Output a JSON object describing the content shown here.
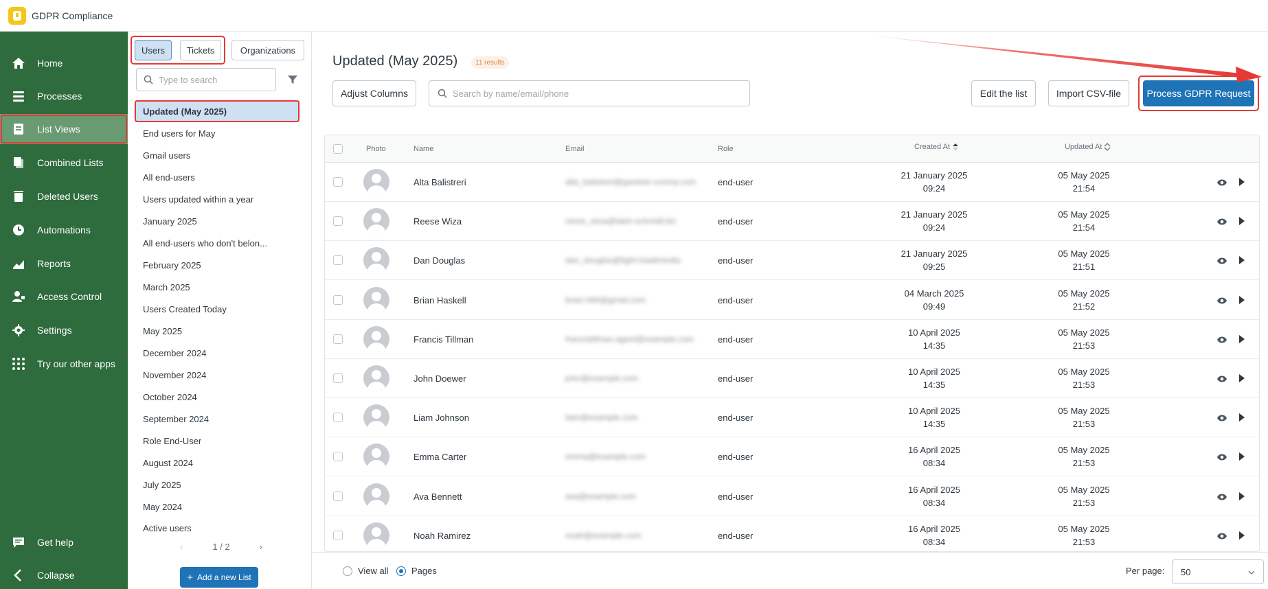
{
  "app": {
    "title": "GDPR Compliance"
  },
  "nav": {
    "items": [
      {
        "label": "Home",
        "icon": "home-icon"
      },
      {
        "label": "Processes",
        "icon": "processes-icon"
      },
      {
        "label": "List Views",
        "icon": "list-views-icon",
        "active": true
      },
      {
        "label": "Combined Lists",
        "icon": "combined-lists-icon"
      },
      {
        "label": "Deleted Users",
        "icon": "deleted-users-icon"
      },
      {
        "label": "Automations",
        "icon": "clock-icon"
      },
      {
        "label": "Reports",
        "icon": "reports-icon"
      },
      {
        "label": "Access Control",
        "icon": "access-control-icon"
      },
      {
        "label": "Settings",
        "icon": "gear-icon"
      },
      {
        "label": "Try our other apps",
        "icon": "apps-grid-icon"
      }
    ],
    "help": "Get help",
    "collapse": "Collapse"
  },
  "listpanel": {
    "tabs": [
      "Users",
      "Tickets",
      "Organizations"
    ],
    "search_placeholder": "Type to search",
    "items": [
      "Updated (May 2025)",
      "End users for May",
      "Gmail users",
      "All end-users",
      "Users updated within a year",
      "January 2025",
      "All end-users who don't belon...",
      "February 2025",
      "March 2025",
      "Users Created Today",
      "May 2025",
      "December 2024",
      "November 2024",
      "October 2024",
      "September 2024",
      "Role End-User",
      "August 2024",
      "July 2025",
      "May 2024",
      "Active users"
    ],
    "pager": "1 / 2",
    "add_button": "Add a new List"
  },
  "main": {
    "title": "Updated (May 2025)",
    "results": "11 results",
    "adjust_columns": "Adjust Columns",
    "search_placeholder": "Search by name/email/phone",
    "edit_list": "Edit the list",
    "import_csv": "Import CSV-file",
    "process_gdpr": "Process GDPR Request"
  },
  "table": {
    "columns": {
      "photo": "Photo",
      "name": "Name",
      "email": "Email",
      "role": "Role",
      "created": "Created At",
      "updated": "Updated At"
    },
    "rows": [
      {
        "name": "Alta Balistreri",
        "email": "alta_balistreri@gardner-conroy.com",
        "role": "end-user",
        "created_date": "21 January 2025",
        "created_time": "09:24",
        "updated_date": "05 May 2025",
        "updated_time": "21:54"
      },
      {
        "name": "Reese Wiza",
        "email": "reese_wiza@lakin-schmidt.biz",
        "role": "end-user",
        "created_date": "21 January 2025",
        "created_time": "09:24",
        "updated_date": "05 May 2025",
        "updated_time": "21:54"
      },
      {
        "name": "Dan Douglas",
        "email": "dan_douglas@light-hawkmedia",
        "role": "end-user",
        "created_date": "21 January 2025",
        "created_time": "09:25",
        "updated_date": "05 May 2025",
        "updated_time": "21:51"
      },
      {
        "name": "Brian Haskell",
        "email": "brian.h84@gmail.com",
        "role": "end-user",
        "created_date": "04 March 2025",
        "created_time": "09:49",
        "updated_date": "05 May 2025",
        "updated_time": "21:52"
      },
      {
        "name": "Francis Tillman",
        "email": "francistillman.agent@example.com",
        "role": "end-user",
        "created_date": "10 April 2025",
        "created_time": "14:35",
        "updated_date": "05 May 2025",
        "updated_time": "21:53"
      },
      {
        "name": "John Doewer",
        "email": "john@example.com",
        "role": "end-user",
        "created_date": "10 April 2025",
        "created_time": "14:35",
        "updated_date": "05 May 2025",
        "updated_time": "21:53"
      },
      {
        "name": "Liam Johnson",
        "email": "liam@example.com",
        "role": "end-user",
        "created_date": "10 April 2025",
        "created_time": "14:35",
        "updated_date": "05 May 2025",
        "updated_time": "21:53"
      },
      {
        "name": "Emma Carter",
        "email": "emma@example.com",
        "role": "end-user",
        "created_date": "16 April 2025",
        "created_time": "08:34",
        "updated_date": "05 May 2025",
        "updated_time": "21:53"
      },
      {
        "name": "Ava Bennett",
        "email": "ava@example.com",
        "role": "end-user",
        "created_date": "16 April 2025",
        "created_time": "08:34",
        "updated_date": "05 May 2025",
        "updated_time": "21:53"
      },
      {
        "name": "Noah Ramirez",
        "email": "noah@example.com",
        "role": "end-user",
        "created_date": "16 April 2025",
        "created_time": "08:34",
        "updated_date": "05 May 2025",
        "updated_time": "21:53"
      }
    ]
  },
  "footer": {
    "view_all": "View all",
    "pages": "Pages",
    "per_page_label": "Per page:",
    "per_page_value": "50"
  },
  "colors": {
    "sidebar": "#2e6b3d",
    "primary": "#1f73b7",
    "highlight": "#e53935"
  }
}
